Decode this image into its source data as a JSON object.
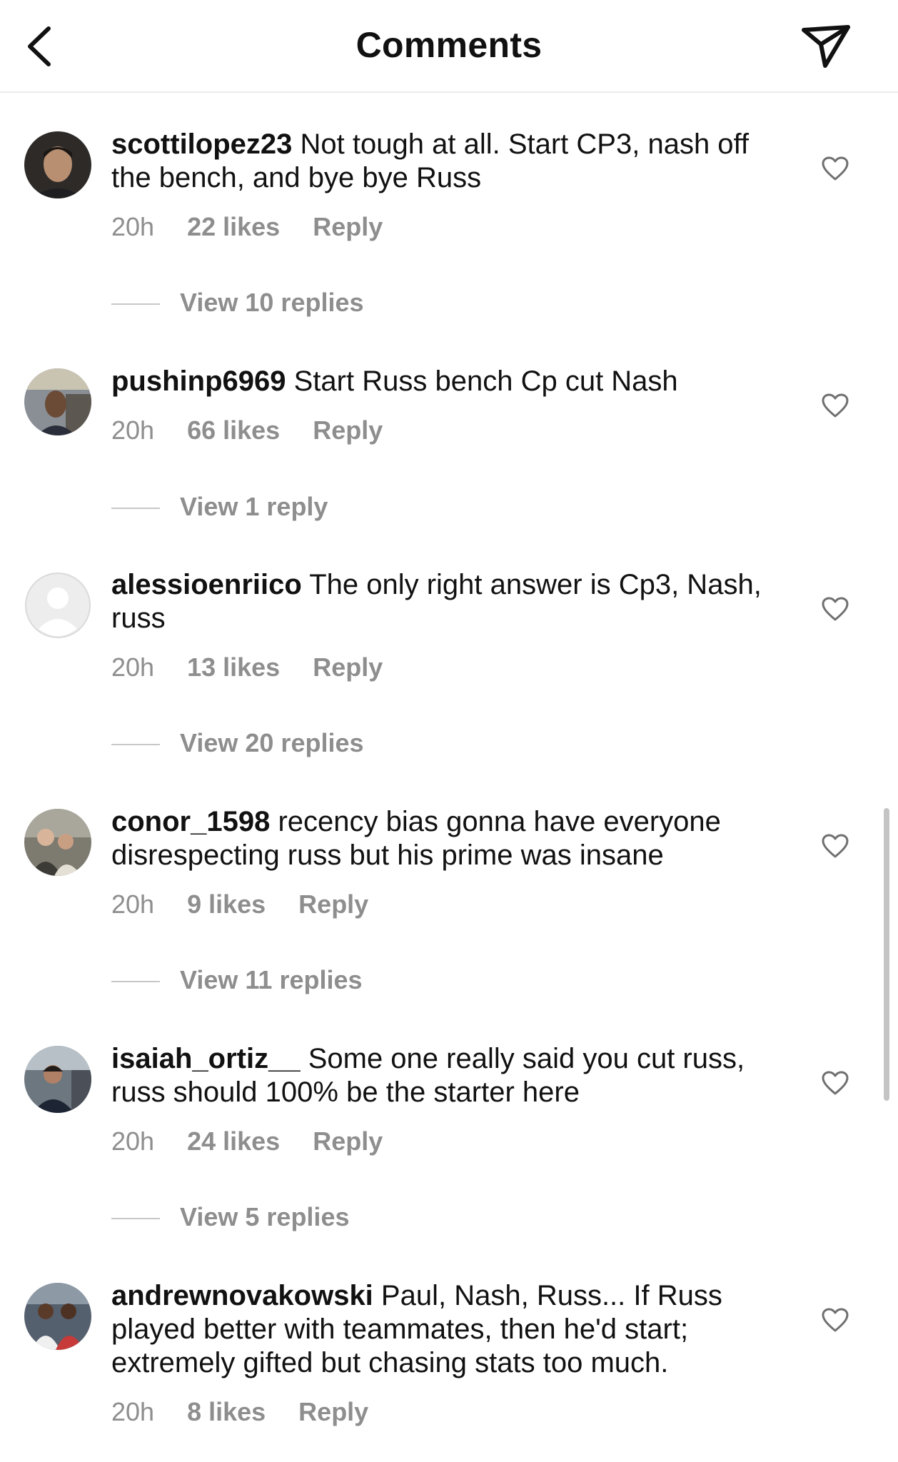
{
  "header": {
    "title": "Comments"
  },
  "comments": [
    {
      "username": "scottilopez23",
      "text": "Not tough at all. Start CP3, nash off the bench, and bye bye Russ",
      "time": "20h",
      "likes": "22 likes",
      "reply": "Reply",
      "view_replies": "View 10 replies"
    },
    {
      "username": "pushinp6969",
      "text": "Start Russ bench Cp cut Nash",
      "time": "20h",
      "likes": "66 likes",
      "reply": "Reply",
      "view_replies": "View 1 reply"
    },
    {
      "username": "alessioenriico",
      "text": "The only right answer is Cp3, Nash, russ",
      "time": "20h",
      "likes": "13 likes",
      "reply": "Reply",
      "view_replies": "View 20 replies"
    },
    {
      "username": "conor_1598",
      "text": "recency bias gonna have everyone disrespecting russ but his prime was insane",
      "time": "20h",
      "likes": "9 likes",
      "reply": "Reply",
      "view_replies": "View 11 replies"
    },
    {
      "username": "isaiah_ortiz__",
      "text": "Some one really said you cut russ, russ should 100% be the starter here",
      "time": "20h",
      "likes": "24 likes",
      "reply": "Reply",
      "view_replies": "View 5 replies"
    },
    {
      "username": "andrewnovakowski",
      "text": "Paul, Nash, Russ... If Russ played better with teammates, then he'd start; extremely gifted but chasing stats too much.",
      "time": "20h",
      "likes": "8 likes",
      "reply": "Reply"
    }
  ],
  "icons": {
    "back": "chevron-left-icon",
    "send": "paper-plane-icon",
    "like": "heart-outline-icon"
  }
}
